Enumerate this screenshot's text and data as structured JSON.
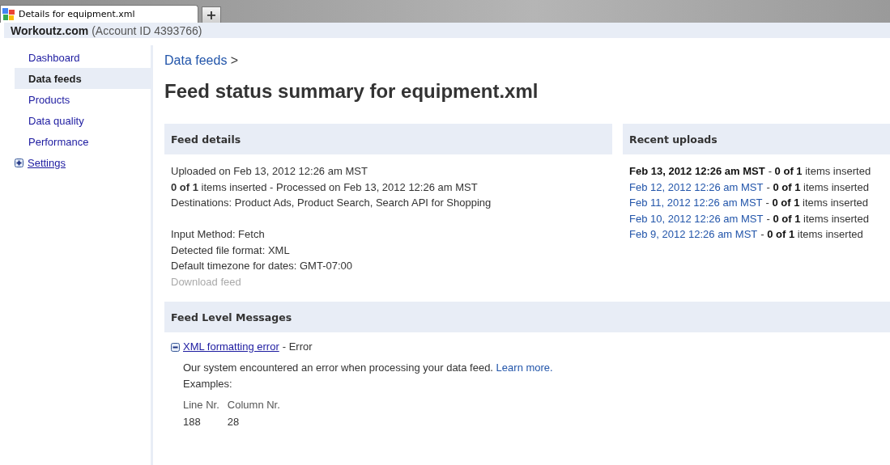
{
  "browser": {
    "tab_title": "Details for equipment.xml",
    "new_tab": "+"
  },
  "header": {
    "site": "Workoutz.com",
    "account": "(Account ID 4393766)"
  },
  "sidebar": {
    "items": [
      {
        "label": "Dashboard",
        "selected": false
      },
      {
        "label": "Data feeds",
        "selected": true
      },
      {
        "label": "Products",
        "selected": false
      },
      {
        "label": "Data quality",
        "selected": false
      },
      {
        "label": "Performance",
        "selected": false
      },
      {
        "label": "Settings",
        "selected": false,
        "expanded": false
      }
    ]
  },
  "breadcrumb": {
    "link": "Data feeds",
    "separator": ">"
  },
  "title": "Feed status summary for equipment.xml",
  "feed_details": {
    "heading": "Feed details",
    "lines": [
      "Uploaded on Feb 13, 2012 12:26 am MST",
      "**0 of 1** items inserted - Processed on Feb 13, 2012 12:26 am MST",
      "Destinations: Product Ads, Product Search, Search API for Shopping"
    ],
    "lines_2": [
      "Input Method: Fetch",
      "Detected file format: XML",
      "Default timezone for dates: GMT-07:00"
    ],
    "download": {
      "label": "Download feed",
      "disabled": true
    }
  },
  "recent_uploads": {
    "heading": "Recent uploads",
    "items": [
      {
        "date": "Feb 13, 2012 12:26 am MST",
        "status": "- **0 of 1** items inserted",
        "selected": true
      },
      {
        "date": "Feb 12, 2012 12:26 am MST",
        "status": "- **0 of 1** items inserted",
        "selected": false
      },
      {
        "date": "Feb 11, 2012 12:26 am MST",
        "status": "- **0 of 1** items inserted",
        "selected": false
      },
      {
        "date": "Feb 10, 2012 12:26 am MST",
        "status": "- **0 of 1** items inserted",
        "selected": false
      },
      {
        "date": "Feb 9, 2012 12:26 am MST",
        "status": "- **0 of 1** items inserted",
        "selected": false
      }
    ]
  },
  "messages": {
    "heading": "Feed Level Messages",
    "items": [
      {
        "title": "XML formatting error",
        "severity": "- Error",
        "expanded": true,
        "text": "Our system encountered an error when processing your data feed.",
        "link": "Learn more.",
        "examples_label": "Examples:",
        "columns": [
          "Line Nr.",
          "Column Nr."
        ],
        "rows": [
          [
            "188",
            "28"
          ]
        ]
      }
    ]
  }
}
